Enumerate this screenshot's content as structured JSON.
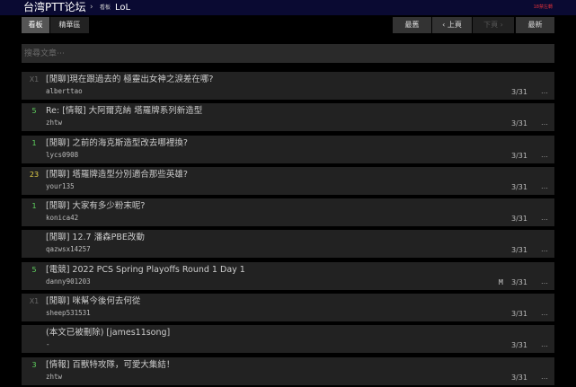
{
  "header": {
    "site_title": "台湾PTT论坛",
    "separator": "›",
    "board_prefix": "看板",
    "board_name": "LoL",
    "right_link": "18禁左轉"
  },
  "nav": {
    "board_label": "看板",
    "digest_label": "精華區",
    "oldest_label": "最舊",
    "prev_label": "‹ 上頁",
    "next_label": "下頁 ›",
    "newest_label": "最新"
  },
  "search": {
    "placeholder": "搜尋文章⋯"
  },
  "colors": {
    "push_green": "#5fd35f",
    "push_yellow": "#e6d24a",
    "push_gray": "#666666"
  },
  "posts": [
    {
      "push": "X1",
      "push_color": "gray",
      "title": "[閒聊]現在跟過去的 極靈出女神之淚差在哪?",
      "author": "alberttao",
      "mark": "",
      "date": "3/31",
      "menu": "…"
    },
    {
      "push": "5",
      "push_color": "green",
      "title": "Re: [情報] 大阿爾克納 塔羅牌系列新造型",
      "author": "zhtw",
      "mark": "",
      "date": "3/31",
      "menu": "…"
    },
    {
      "push": "1",
      "push_color": "green",
      "title": "[閒聊] 之前的海克斯造型改去哪裡換?",
      "author": "lycs0908",
      "mark": "",
      "date": "3/31",
      "menu": "…"
    },
    {
      "push": "23",
      "push_color": "yellow",
      "title": "[閒聊] 塔羅牌造型分別適合那些英雄?",
      "author": "your135",
      "mark": "",
      "date": "3/31",
      "menu": "…"
    },
    {
      "push": "1",
      "push_color": "green",
      "title": "[閒聊] 大家有多少粉末呢?",
      "author": "konica42",
      "mark": "",
      "date": "3/31",
      "menu": "…"
    },
    {
      "push": "",
      "push_color": "green",
      "title": "[閒聊] 12.7 潘森PBE改動",
      "author": "qazwsx14257",
      "mark": "",
      "date": "3/31",
      "menu": "…"
    },
    {
      "push": "5",
      "push_color": "green",
      "title": "[電競] 2022 PCS Spring Playoffs Round 1 Day 1",
      "author": "danny901203",
      "mark": "M",
      "date": "3/31",
      "menu": "…"
    },
    {
      "push": "X1",
      "push_color": "gray",
      "title": "[閒聊] 咪幫今後何去何從",
      "author": "sheep531531",
      "mark": "",
      "date": "3/31",
      "menu": "…"
    },
    {
      "push": "",
      "push_color": "green",
      "title": "(本文已被刪除) [james11song]",
      "author": "-",
      "mark": "",
      "date": "3/31",
      "menu": "…"
    },
    {
      "push": "3",
      "push_color": "green",
      "title": "[情報] 百獸特攻隊，可愛大集結！",
      "author": "zhtw",
      "mark": "",
      "date": "3/31",
      "menu": "…"
    }
  ]
}
